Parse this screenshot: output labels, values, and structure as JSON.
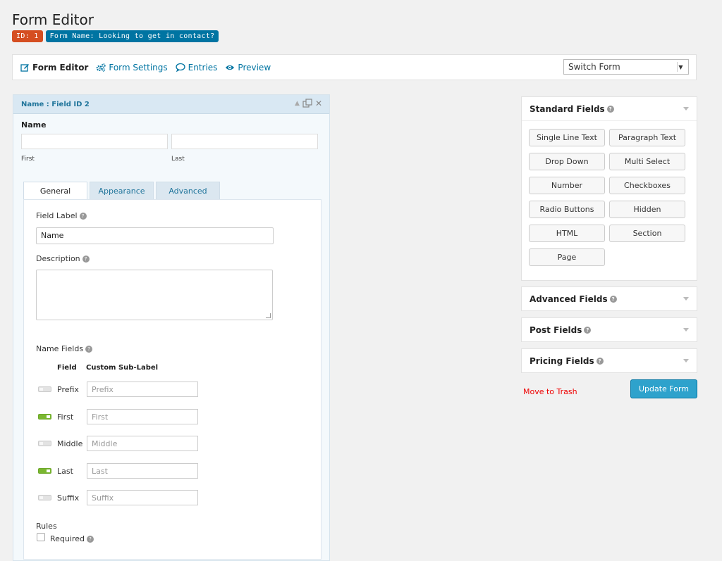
{
  "header": {
    "title": "Form Editor",
    "id_badge": "ID: 1",
    "name_badge": "Form Name: Looking to get in contact?"
  },
  "toolbar": {
    "items": [
      {
        "label": "Form Editor",
        "icon": "edit-icon"
      },
      {
        "label": "Form Settings",
        "icon": "gears-icon"
      },
      {
        "label": "Entries",
        "icon": "comment-icon"
      },
      {
        "label": "Preview",
        "icon": "eye-icon"
      }
    ],
    "switch_form": "Switch Form"
  },
  "field": {
    "header": "Name : Field ID 2",
    "preview_label": "Name",
    "sub_first": "First",
    "sub_last": "Last",
    "tabs": [
      "General",
      "Appearance",
      "Advanced"
    ],
    "field_label_title": "Field Label",
    "field_label_value": "Name",
    "description_title": "Description",
    "name_fields_title": "Name Fields",
    "col_field": "Field",
    "col_custom": "Custom Sub-Label",
    "name_fields": [
      {
        "name": "Prefix",
        "placeholder": "Prefix",
        "enabled": false
      },
      {
        "name": "First",
        "placeholder": "First",
        "enabled": true
      },
      {
        "name": "Middle",
        "placeholder": "Middle",
        "enabled": false
      },
      {
        "name": "Last",
        "placeholder": "Last",
        "enabled": true
      },
      {
        "name": "Suffix",
        "placeholder": "Suffix",
        "enabled": false
      }
    ],
    "rules_title": "Rules",
    "required_label": "Required"
  },
  "sidebar": {
    "standard_title": "Standard Fields",
    "standard_buttons": [
      "Single Line Text",
      "Paragraph Text",
      "Drop Down",
      "Multi Select",
      "Number",
      "Checkboxes",
      "Radio Buttons",
      "Hidden",
      "HTML",
      "Section",
      "Page"
    ],
    "advanced_title": "Advanced Fields",
    "post_title": "Post Fields",
    "pricing_title": "Pricing Fields",
    "trash_label": "Move to Trash",
    "update_label": "Update Form"
  },
  "colors": {
    "accent": "#0074a2",
    "badge_id": "#d54e21",
    "toggle_on": "#7ab730",
    "update_button": "#2ea2cc",
    "trash": "#ee0000"
  }
}
